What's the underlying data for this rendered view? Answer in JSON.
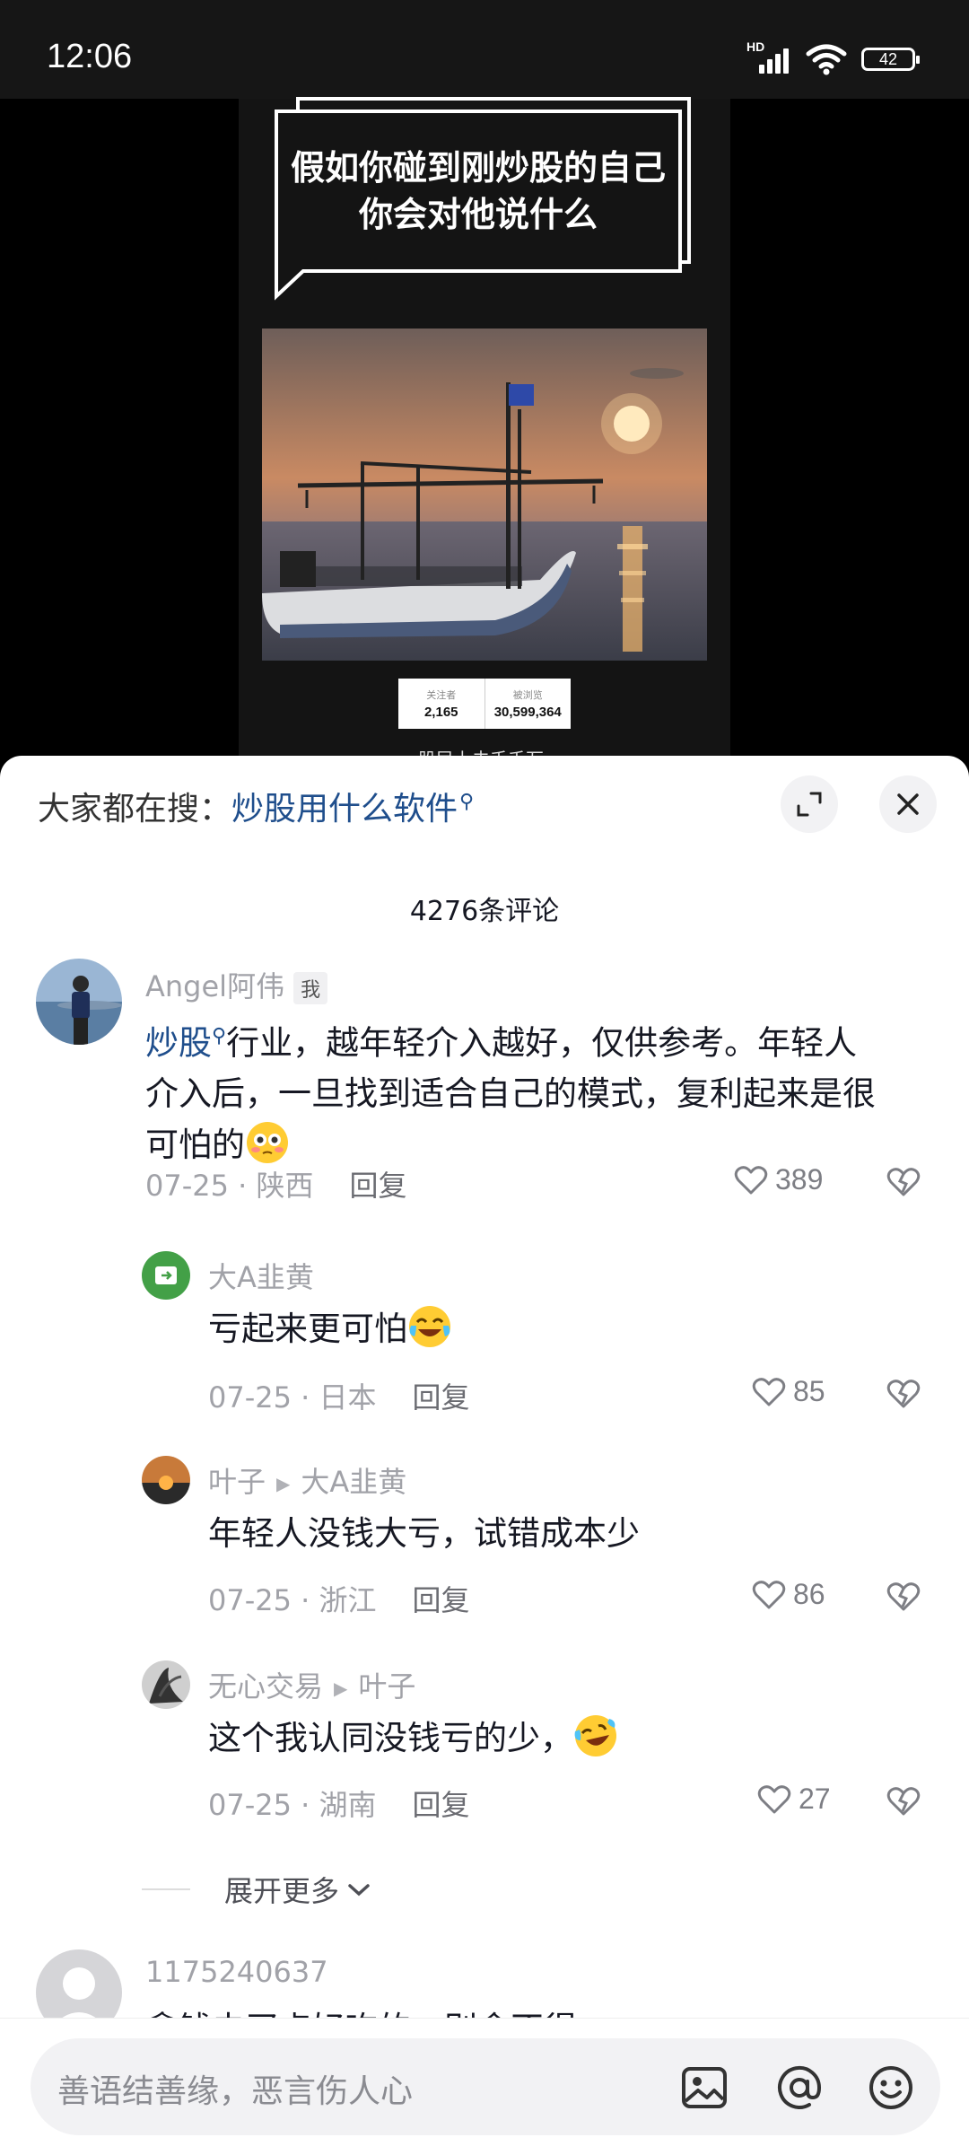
{
  "status": {
    "time": "12:06",
    "network": "HD",
    "battery": "42"
  },
  "video": {
    "caption_line1": "假如你碰到刚炒股的自己",
    "caption_line2": "你会对他说什么",
    "stats": [
      {
        "label": "关注者",
        "value": "2,165"
      },
      {
        "label": "被浏览",
        "value": "30,599,364"
      }
    ],
    "cut_text": "股民上去千千万"
  },
  "sheet": {
    "search_prefix": "大家都在搜：",
    "search_term": "炒股用什么软件",
    "comment_count": "4276条评论"
  },
  "comments": [
    {
      "user": "Angel阿伟",
      "tag": "我",
      "keyword": "炒股",
      "text_after_keyword": "行业，越年轻介入越好，仅供参考。年轻人",
      "line2": "介入后，一旦找到适合自己的模式，复利起来是很",
      "line3": "可怕的",
      "date": "07-25",
      "location": "陕西",
      "reply": "回复",
      "likes": "389"
    },
    {
      "user": "大A韭黄",
      "text": "亏起来更可怕",
      "date": "07-25",
      "location": "日本",
      "reply": "回复",
      "likes": "85"
    },
    {
      "user": "叶子",
      "reply_to": "大A韭黄",
      "text": "年轻人没钱大亏，试错成本少",
      "date": "07-25",
      "location": "浙江",
      "reply": "回复",
      "likes": "86"
    },
    {
      "user": "无心交易",
      "reply_to": "叶子",
      "text": "这个我认同没钱亏的少，",
      "date": "07-25",
      "location": "湖南",
      "reply": "回复",
      "likes": "27"
    },
    {
      "user": "1175240637",
      "text": "拿钱去买点好吃的，别舍不得"
    }
  ],
  "expand_label": "展开更多",
  "input": {
    "placeholder": "善语结善缘，恶言伤人心"
  },
  "icons": [
    "expand-icon",
    "close-icon",
    "heart-icon",
    "dislike-icon",
    "image-icon",
    "at-icon",
    "emoji-icon",
    "search-icon",
    "chevron-down-icon"
  ]
}
